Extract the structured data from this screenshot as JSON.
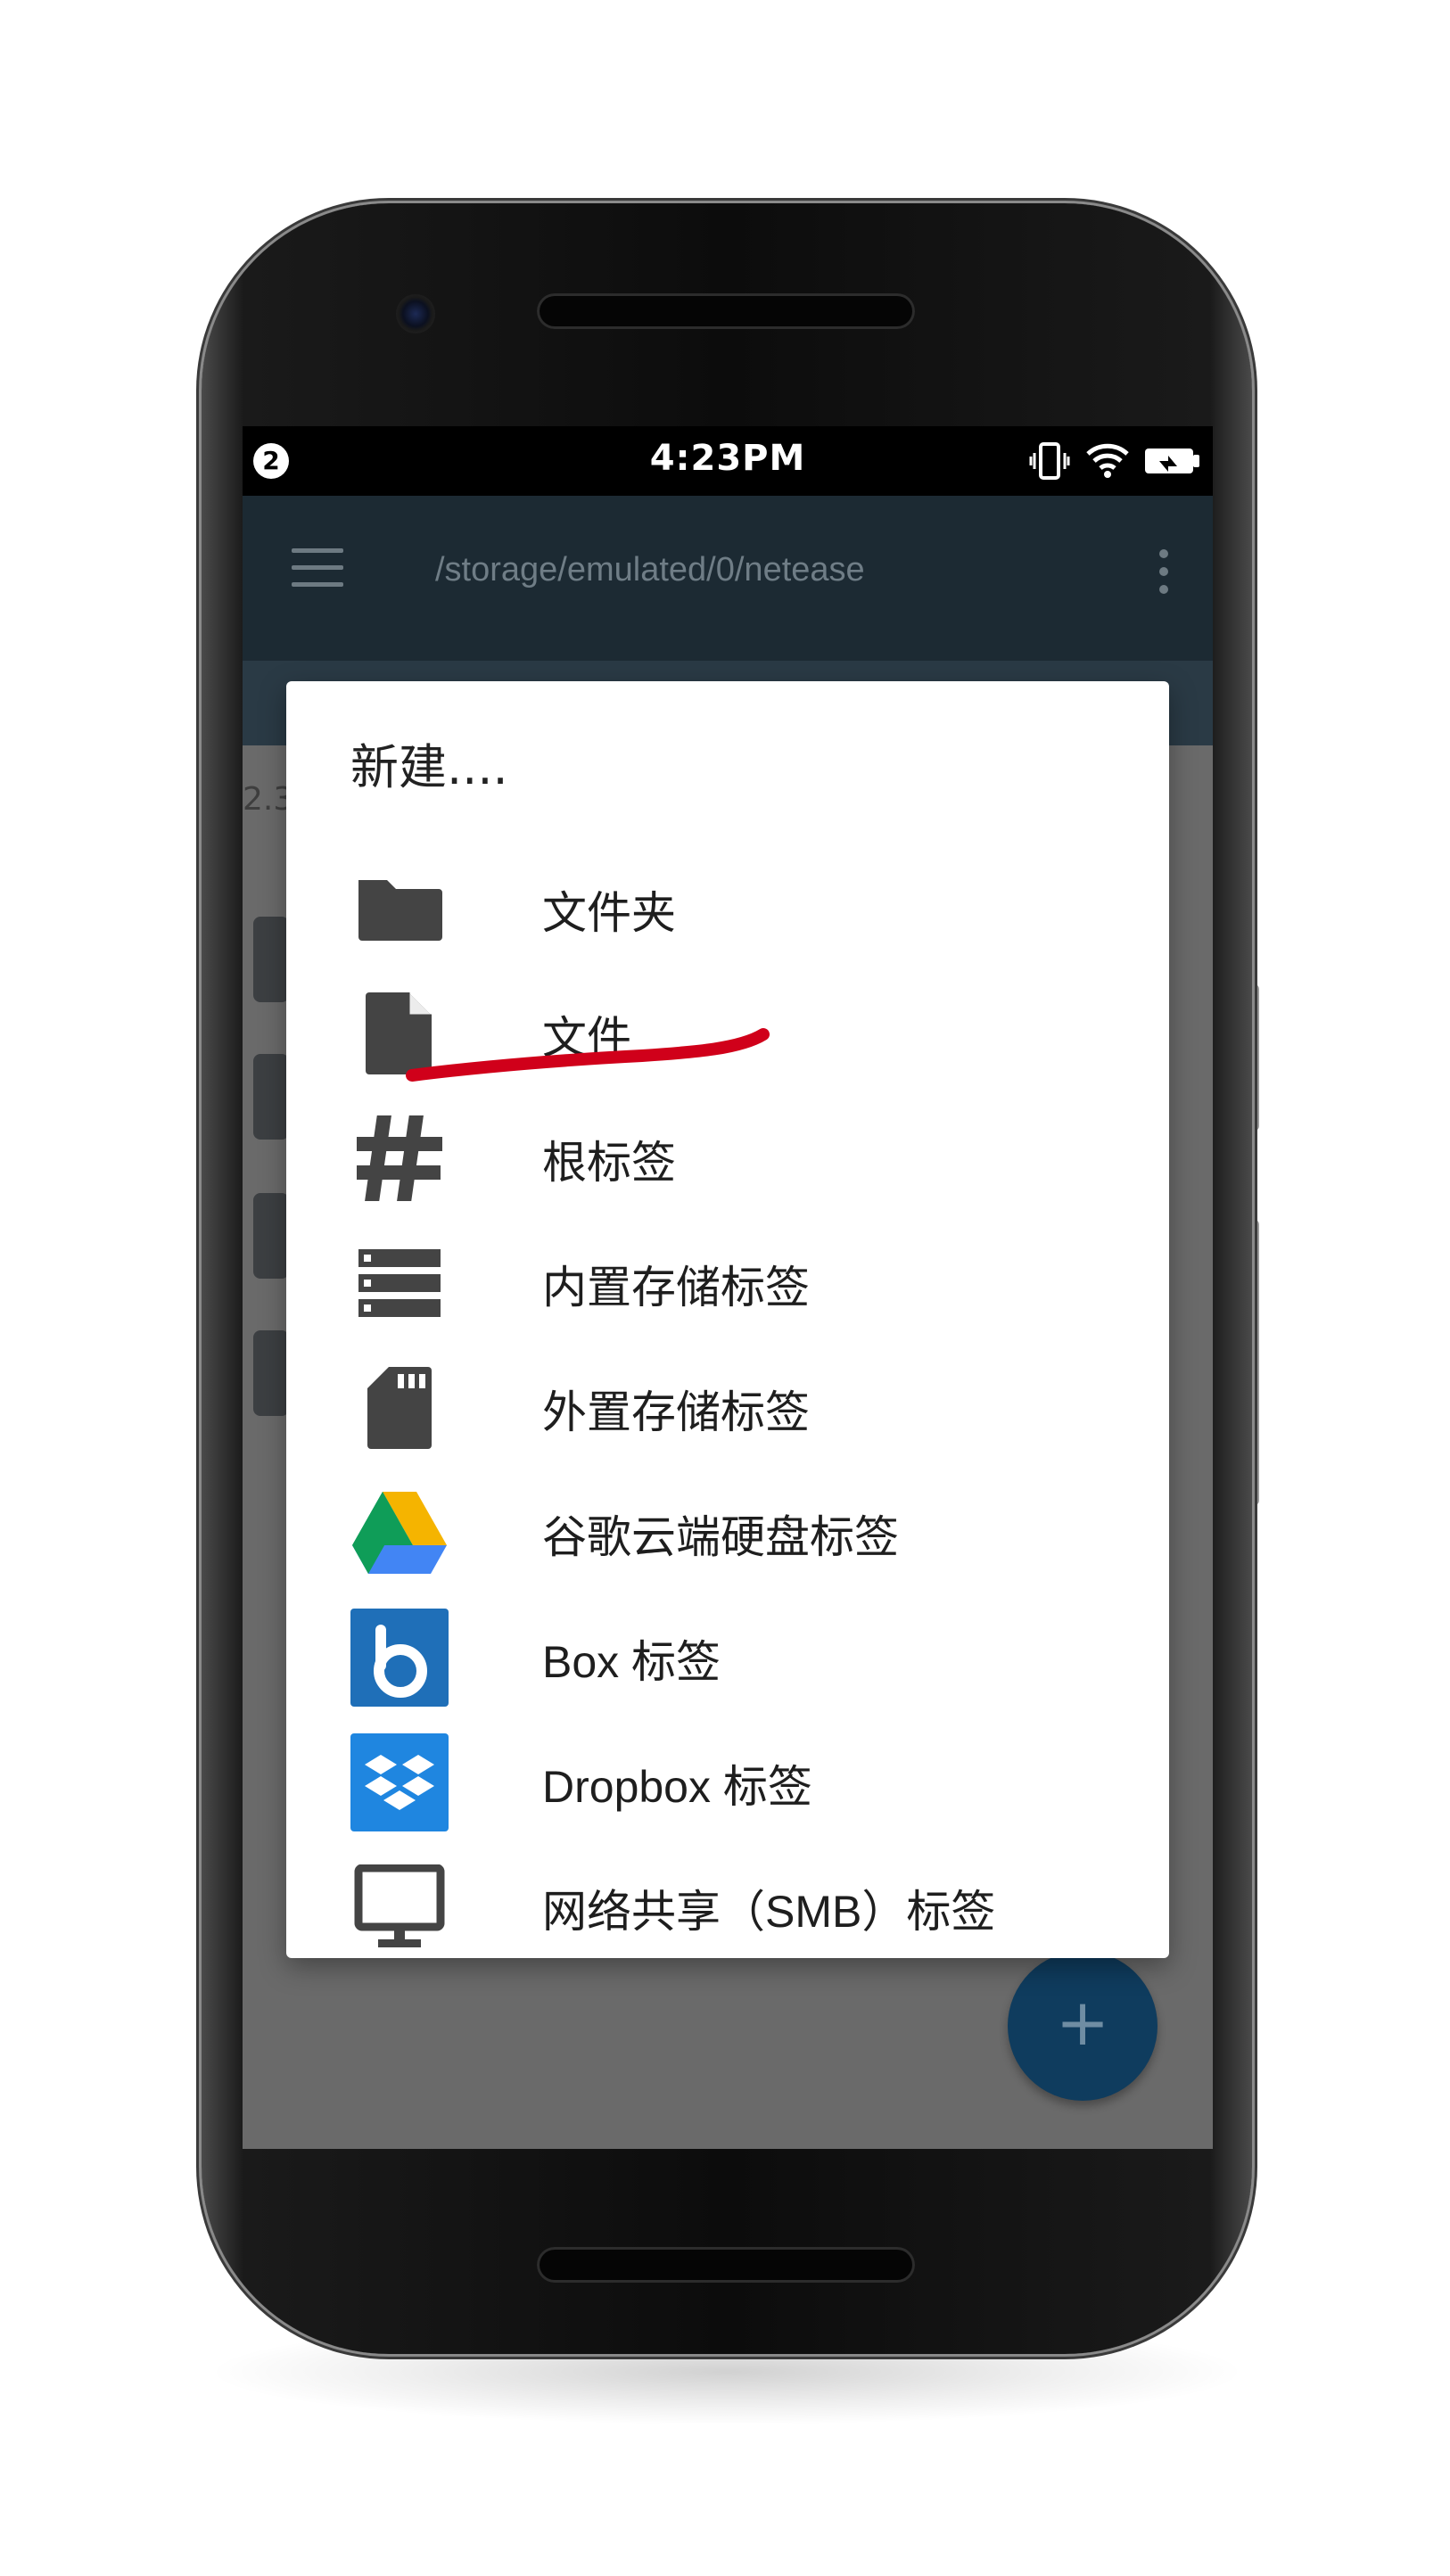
{
  "status_bar": {
    "notification_count": "2",
    "time": "4:23PM"
  },
  "toolbar": {
    "path": "/storage/emulated/0/netease"
  },
  "background_list": {
    "partial_size_label": "2.3"
  },
  "dialog": {
    "title": "新建....",
    "items": [
      {
        "label": "文件夹",
        "icon": "folder-icon"
      },
      {
        "label": "文件",
        "icon": "file-icon"
      },
      {
        "label": "根标签",
        "icon": "hash-icon"
      },
      {
        "label": "内置存储标签",
        "icon": "storage-icon"
      },
      {
        "label": "外置存储标签",
        "icon": "sd-card-icon"
      },
      {
        "label": "谷歌云端硬盘标签",
        "icon": "google-drive-icon"
      },
      {
        "label": "Box 标签",
        "icon": "box-icon"
      },
      {
        "label": "Dropbox 标签",
        "icon": "dropbox-icon"
      },
      {
        "label": "网络共享（SMB）标签",
        "icon": "monitor-icon"
      }
    ]
  },
  "fab": {
    "label": "+"
  },
  "colors": {
    "toolbar": "#1c2a33",
    "annotation_stroke": "#d0001a",
    "icon_gray": "#444444",
    "box_blue": "#1f6fb8",
    "dropbox_blue": "#1f86e0"
  }
}
